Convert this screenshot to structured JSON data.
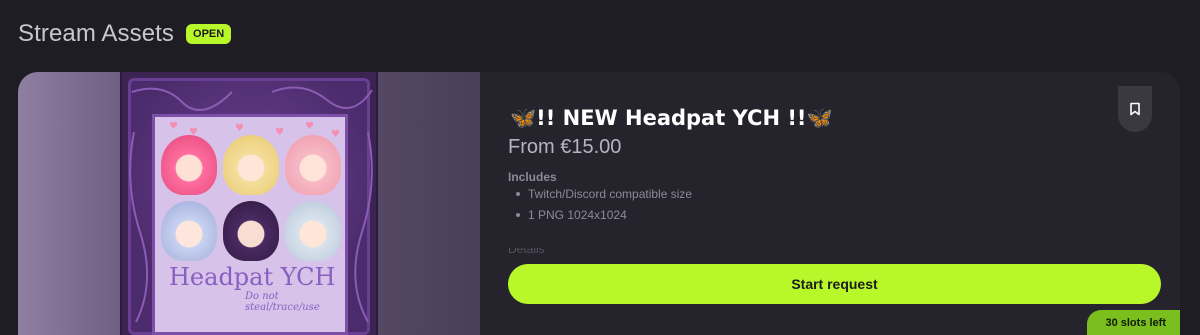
{
  "section": {
    "title": "Stream Assets",
    "status_badge": "OPEN"
  },
  "listing": {
    "title": "🦋!! NEW Headpat YCH !!🦋",
    "price": "From €15.00",
    "includes_heading": "Includes",
    "includes": [
      "Twitch/Discord compatible size",
      "1 PNG 1024x1024"
    ],
    "details_heading": "Details",
    "start_button_label": "Start request",
    "slots_left": "30 slots left",
    "bookmark_icon": "bookmark-icon"
  },
  "artwork": {
    "title": "Headpat YCH",
    "subtitle": "Do not steal/trace/use"
  },
  "colors": {
    "accent": "#b8f82a",
    "background": "#1f1d24",
    "card": "#25242c"
  }
}
